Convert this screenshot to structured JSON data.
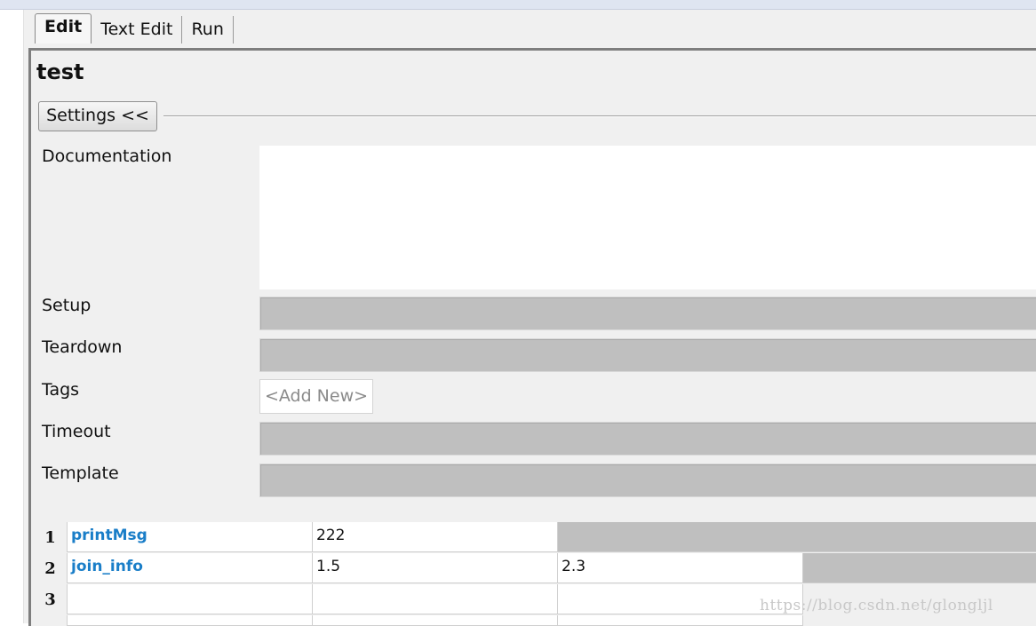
{
  "tabs": [
    {
      "label": "Edit",
      "active": true
    },
    {
      "label": "Text Edit",
      "active": false
    },
    {
      "label": "Run",
      "active": false
    }
  ],
  "editor": {
    "title": "test",
    "settings_button": "Settings <<",
    "fields": {
      "documentation": "Documentation",
      "setup": "Setup",
      "teardown": "Teardown",
      "tags": "Tags",
      "tags_placeholder": "<Add New>",
      "timeout": "Timeout",
      "template": "Template"
    }
  },
  "grid": {
    "rows": [
      {
        "num": "1",
        "cells": [
          "printMsg",
          "222",
          ""
        ]
      },
      {
        "num": "2",
        "cells": [
          "join_info",
          "1.5",
          "2.3"
        ]
      },
      {
        "num": "3",
        "cells": [
          "",
          "",
          ""
        ]
      }
    ]
  },
  "watermark": "https://blog.csdn.net/glongljl",
  "colors": {
    "keyword": "#1a7ec8",
    "field_disabled": "#bfbfbf",
    "panel_bg": "#f0f0f0"
  }
}
